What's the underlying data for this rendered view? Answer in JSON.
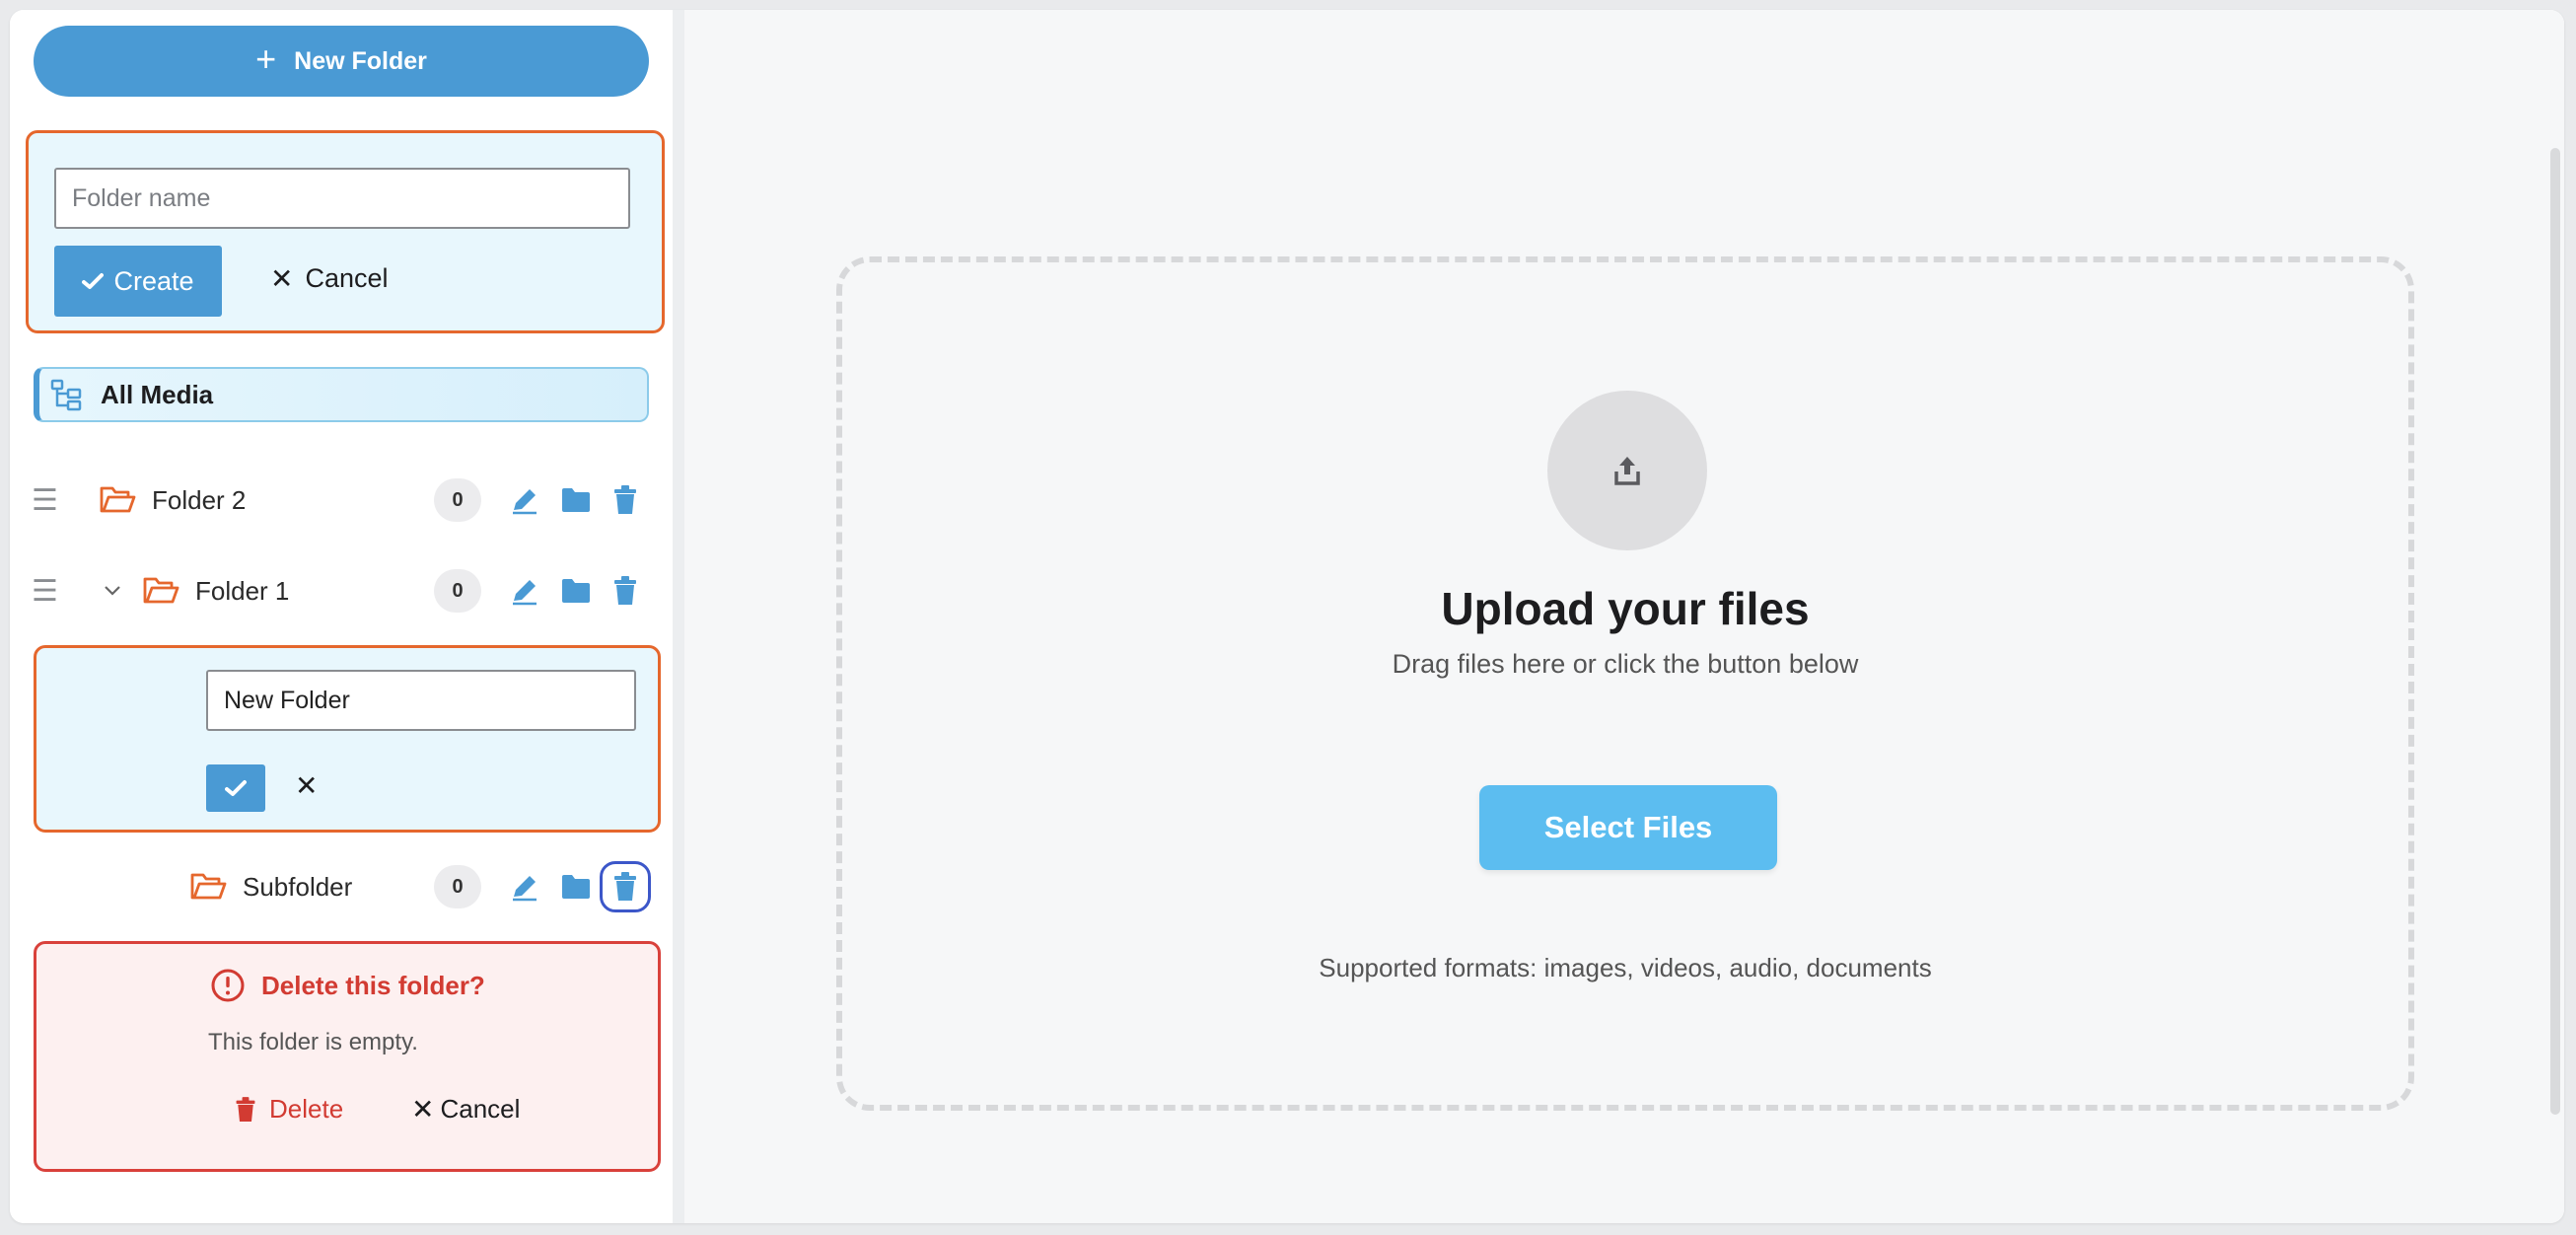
{
  "sidebar": {
    "new_folder_button": "New Folder",
    "create_panel": {
      "placeholder": "Folder name",
      "value": "",
      "create_label": "Create",
      "cancel_label": "Cancel"
    },
    "all_media_label": "All Media",
    "folders": [
      {
        "name": "Folder 2",
        "count": "0"
      },
      {
        "name": "Folder 1",
        "count": "0",
        "expanded": true
      }
    ],
    "subfolder_create": {
      "value": "New Folder"
    },
    "subfolders": [
      {
        "name": "Subfolder",
        "count": "0"
      }
    ],
    "delete_confirm": {
      "title": "Delete this folder?",
      "message": "This folder is empty.",
      "delete_label": "Delete",
      "cancel_label": "Cancel"
    }
  },
  "upload": {
    "title": "Upload your files",
    "subtitle": "Drag files here or click the button below",
    "button_label": "Select Files",
    "formats": "Supported formats: images, videos, audio, documents"
  },
  "colors": {
    "accent_blue": "#4a9ad4",
    "folder_orange": "#e5672d",
    "danger_red": "#d23b32",
    "select_button": "#5cbdf0"
  },
  "icons": {
    "new_folder": "plus-icon",
    "all_media": "tree-icon",
    "folder": "folder-open-icon",
    "edit": "pencil-icon",
    "move": "folder-icon",
    "delete": "trash-icon",
    "upload": "upload-icon",
    "alert": "alert-circle-icon"
  }
}
